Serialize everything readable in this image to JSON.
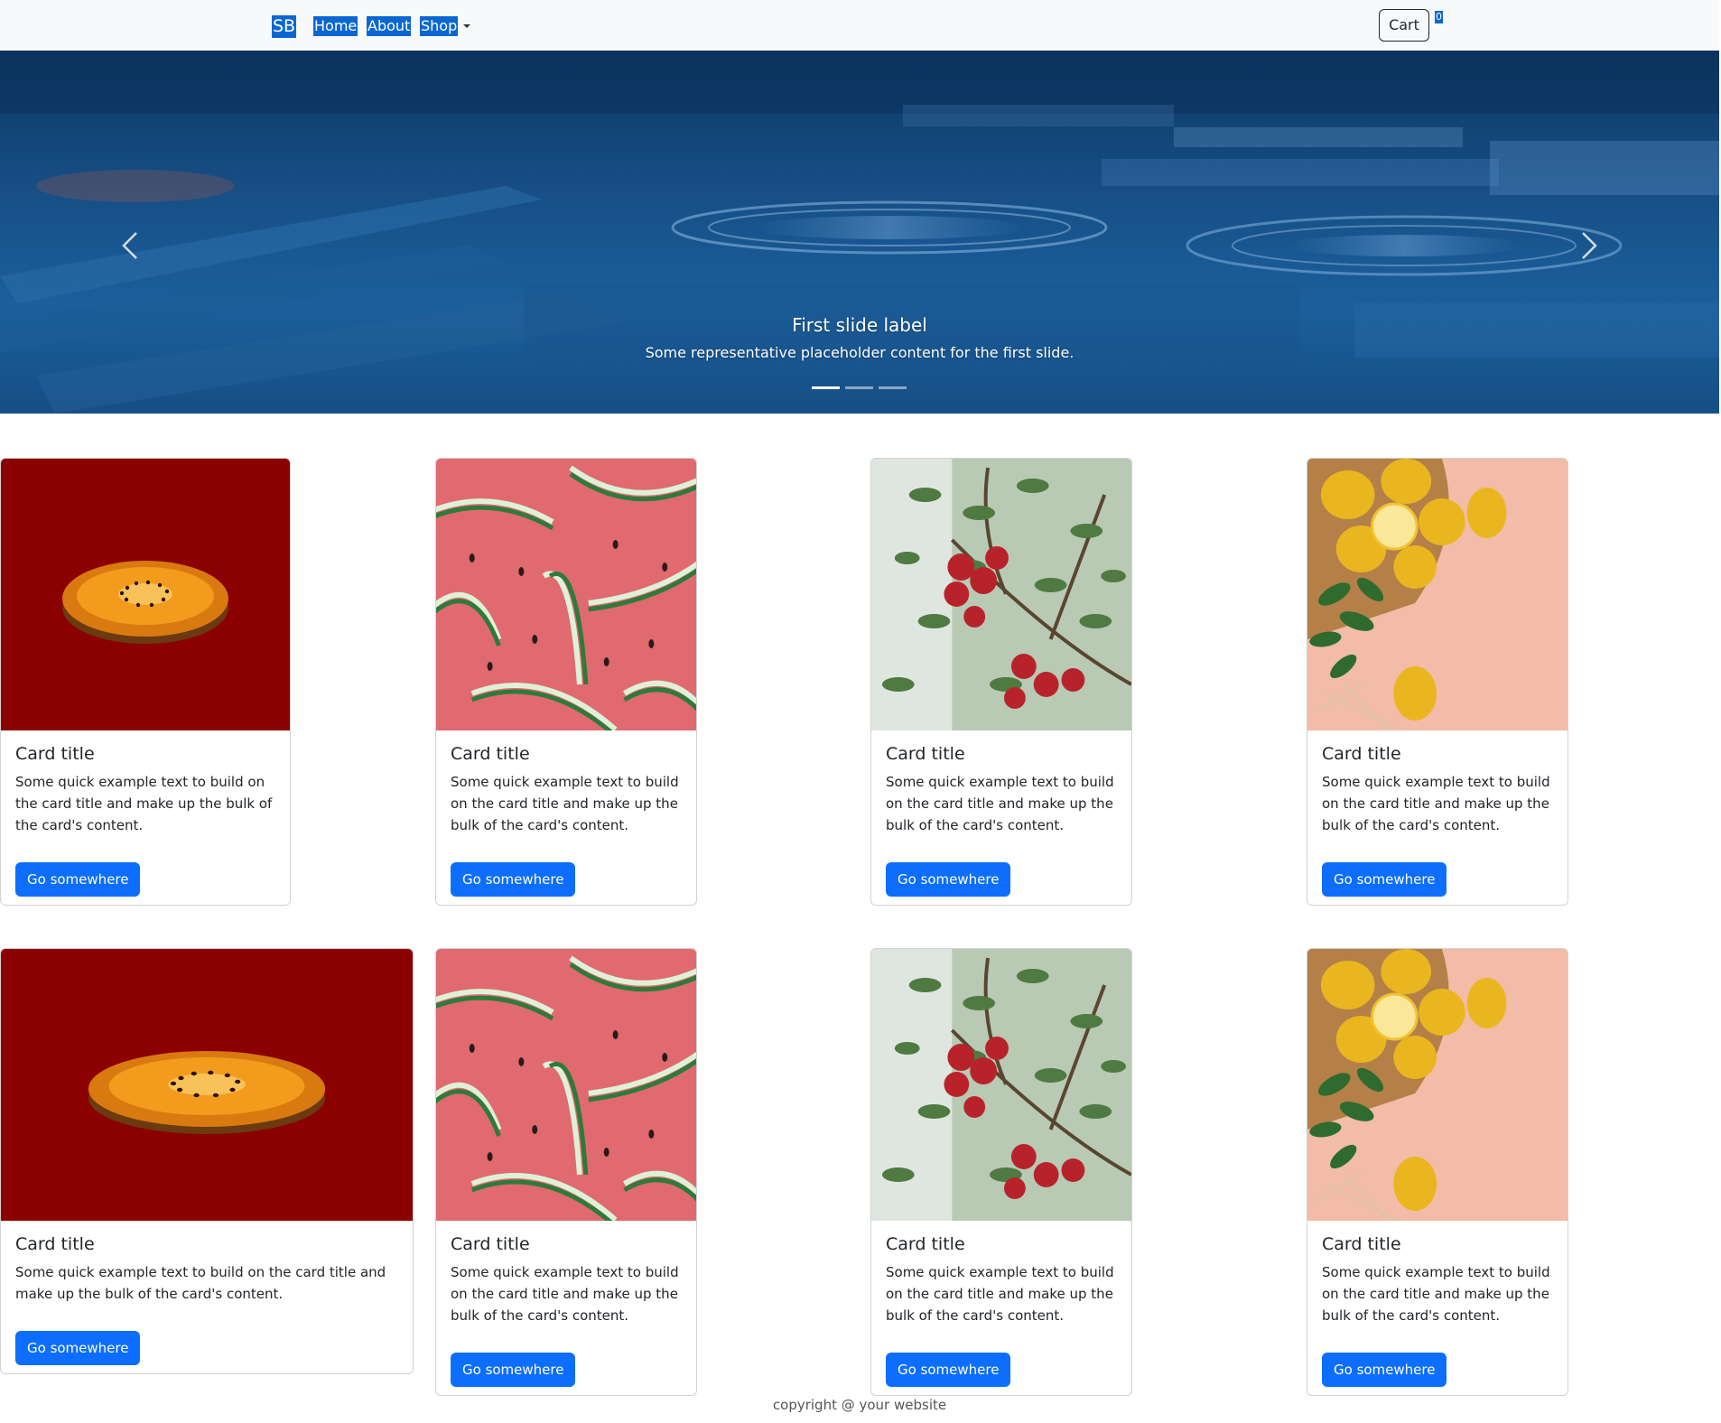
{
  "navbar": {
    "brand": "SB",
    "links": [
      "Home",
      "About",
      "Shop"
    ],
    "cart_label": "Cart",
    "cart_count": "0"
  },
  "carousel": {
    "slide_title": "First slide label",
    "slide_text": "Some representative placeholder content for the first slide.",
    "slide_count": 3,
    "active_slide": 0,
    "prev_icon": "chevron-left-icon",
    "next_icon": "chevron-right-icon"
  },
  "cards": [
    {
      "image": "kiwi-slice",
      "title": "Card title",
      "text": "Some quick example text to build on the card title and make up the bulk of the card's content.",
      "button": "Go somewhere"
    },
    {
      "image": "watermelon-slices",
      "title": "Card title",
      "text": "Some quick example text to build on the card title and make up the bulk of the card's content.",
      "button": "Go somewhere"
    },
    {
      "image": "apple-tree",
      "title": "Card title",
      "text": "Some quick example text to build on the card title and make up the bulk of the card's content.",
      "button": "Go somewhere"
    },
    {
      "image": "lemons",
      "title": "Card title",
      "text": "Some quick example text to build on the card title and make up the bulk of the card's content.",
      "button": "Go somewhere"
    },
    {
      "image": "kiwi-slice",
      "title": "Card title",
      "text": "Some quick example text to build on the card title and make up the bulk of the card's content.",
      "button": "Go somewhere"
    },
    {
      "image": "watermelon-slices",
      "title": "Card title",
      "text": "Some quick example text to build on the card title and make up the bulk of the card's content.",
      "button": "Go somewhere"
    },
    {
      "image": "apple-tree",
      "title": "Card title",
      "text": "Some quick example text to build on the card title and make up the bulk of the card's content.",
      "button": "Go somewhere"
    },
    {
      "image": "lemons",
      "title": "Card title",
      "text": "Some quick example text to build on the card title and make up the bulk of the card's content.",
      "button": "Go somewhere"
    }
  ],
  "footer": {
    "text": "copyright @ your website"
  },
  "colors": {
    "primary": "#0d6efd",
    "nav_highlight": "#0a67d2",
    "navbar_bg": "#f8f9fa",
    "carousel_tint": "#174f86",
    "kiwi_bg": "#8b0000"
  }
}
